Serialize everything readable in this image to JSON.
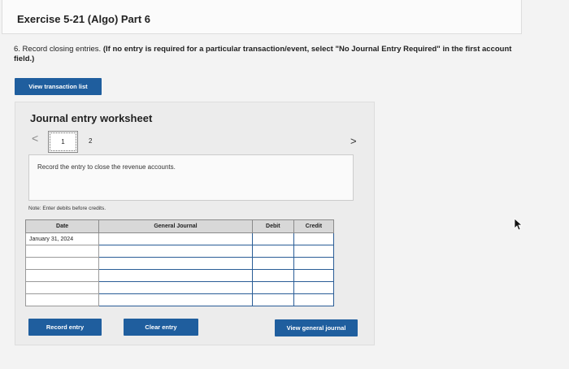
{
  "header": {
    "title": "Exercise 5-21 (Algo) Part 6"
  },
  "instructions": {
    "prefix": "6. Record closing entries.",
    "bold": "(If no entry is required for a particular transaction/event, select \"No Journal Entry Required\" in the first account field.)"
  },
  "buttons": {
    "view_transaction_list": "View transaction list",
    "record_entry": "Record entry",
    "clear_entry": "Clear entry",
    "view_general_journal": "View general journal"
  },
  "worksheet": {
    "title": "Journal entry worksheet",
    "nav_prev": "<",
    "nav_next": ">",
    "pages": [
      "1",
      "2"
    ],
    "current_page": "1",
    "entry_text": "Record the entry to close the revenue accounts.",
    "note": "Note: Enter debits before credits."
  },
  "table": {
    "headers": {
      "date": "Date",
      "general_journal": "General Journal",
      "debit": "Debit",
      "credit": "Credit"
    },
    "rows": [
      {
        "date": "January 31, 2024",
        "account": "",
        "debit": "",
        "credit": ""
      },
      {
        "date": "",
        "account": "",
        "debit": "",
        "credit": ""
      },
      {
        "date": "",
        "account": "",
        "debit": "",
        "credit": ""
      },
      {
        "date": "",
        "account": "",
        "debit": "",
        "credit": ""
      },
      {
        "date": "",
        "account": "",
        "debit": "",
        "credit": ""
      },
      {
        "date": "",
        "account": "",
        "debit": "",
        "credit": ""
      }
    ]
  },
  "colors": {
    "button_blue": "#1f5e9e",
    "header_gray": "#d8d8d8",
    "input_border": "#2a5d96"
  }
}
